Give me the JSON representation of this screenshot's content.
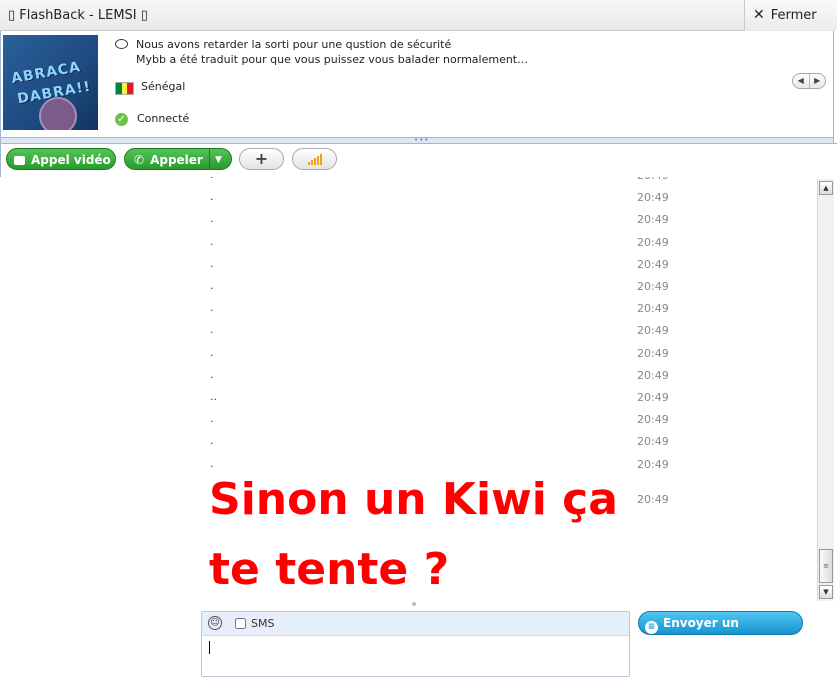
{
  "window": {
    "title": "FlashBack - LEMSI",
    "close_label": "Fermer"
  },
  "profile": {
    "avatar_text_1": "ABRACA",
    "avatar_text_2": "DABRA!!",
    "mood_line_1": "Nous avons retarder la sorti pour une qustion de sécurité",
    "mood_line_2": "Mybb a été traduit pour que vous puissez vous balader normalement…",
    "country": "Sénégal",
    "status": "Connecté"
  },
  "toolbar": {
    "video_call_label": "Appel vidéo",
    "call_label": "Appeler",
    "add_label": "+"
  },
  "chat": {
    "messages": [
      {
        "text": ".",
        "time": "20:49"
      },
      {
        "text": ".",
        "time": "20:49"
      },
      {
        "text": ".",
        "time": "20:49"
      },
      {
        "text": ".",
        "time": "20:49"
      },
      {
        "text": ".",
        "time": "20:49"
      },
      {
        "text": ".",
        "time": "20:49"
      },
      {
        "text": ".",
        "time": "20:49"
      },
      {
        "text": ".",
        "time": "20:49"
      },
      {
        "text": ".",
        "time": "20:49"
      },
      {
        "text": ".",
        "time": "20:49"
      },
      {
        "text": "..",
        "time": "20:49"
      },
      {
        "text": ".",
        "time": "20:49"
      },
      {
        "text": ".",
        "time": "20:49"
      },
      {
        "text": ".",
        "time": "20:49"
      }
    ],
    "big_message": "Sinon un Kiwi ça te tente ?",
    "big_message_time": "20:49",
    "message_color": "#ff0000"
  },
  "input": {
    "sms_label": "SMS",
    "send_label": "Envoyer un message"
  },
  "colors": {
    "call_green": "#2a9a2e",
    "send_blue": "#1795cf",
    "panel_border": "#9db7d6"
  }
}
